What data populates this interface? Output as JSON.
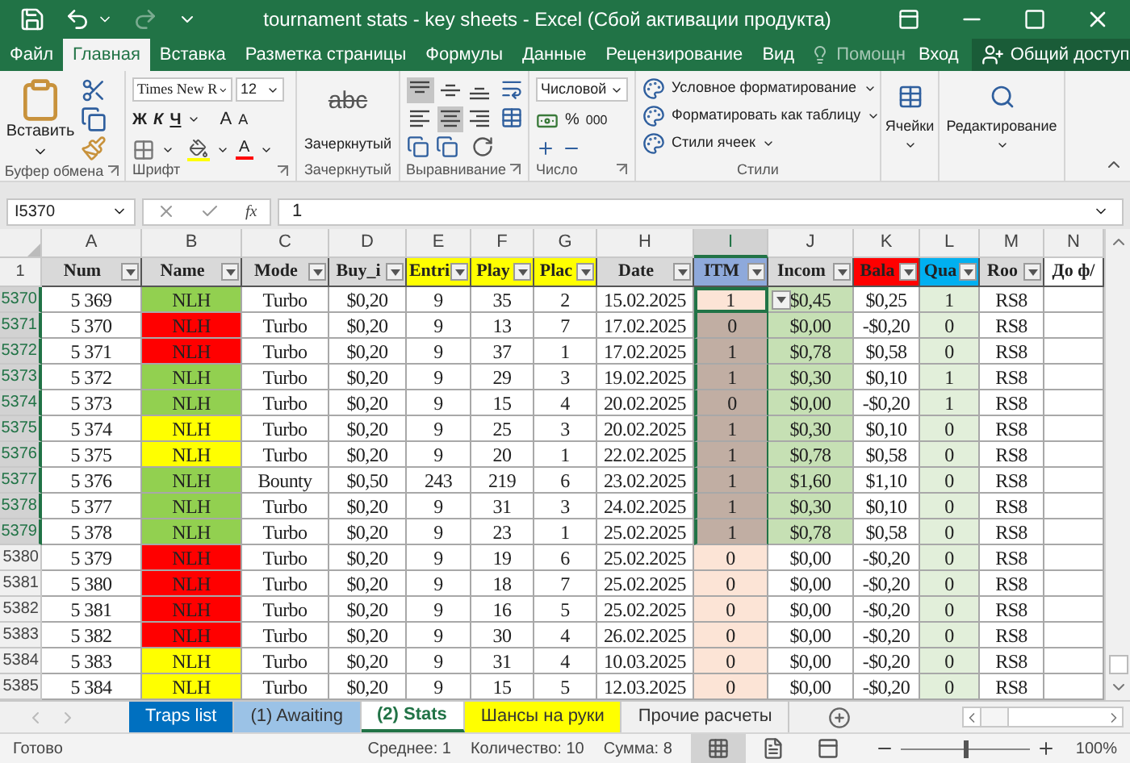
{
  "window": {
    "title": "tournament stats - key sheets - Excel (Сбой активации продукта)"
  },
  "tabs": [
    {
      "label": "Файл",
      "selected": false
    },
    {
      "label": "Главная",
      "selected": true
    },
    {
      "label": "Вставка",
      "selected": false
    },
    {
      "label": "Разметка страницы",
      "selected": false
    },
    {
      "label": "Формулы",
      "selected": false
    },
    {
      "label": "Данные",
      "selected": false
    },
    {
      "label": "Рецензирование",
      "selected": false
    },
    {
      "label": "Вид",
      "selected": false
    }
  ],
  "tell_me": "Помощн",
  "sign_in": "Вход",
  "share": "Общий доступ",
  "ribbon": {
    "clipboard": {
      "paste": "Вставить",
      "label": "Буфер обмена"
    },
    "font": {
      "name": "Times New R",
      "size": "12",
      "bold": "Ж",
      "italic": "К",
      "underline": "Ч",
      "grow": "A",
      "shrink": "A",
      "font_color": "A",
      "label": "Шрифт"
    },
    "strike": {
      "sample": "abc",
      "button": "Зачеркнутый",
      "label": "Зачеркнутый"
    },
    "alignment": {
      "buttons": [
        {
          "kind": "top",
          "selected": true
        },
        {
          "kind": "middle",
          "selected": false
        },
        {
          "kind": "bottom",
          "selected": false
        },
        {
          "kind": "left",
          "selected": false
        },
        {
          "kind": "center",
          "selected": true
        },
        {
          "kind": "right",
          "selected": false
        }
      ],
      "label": "Выравнивание"
    },
    "number": {
      "format": "Числовой",
      "percent": "%",
      "thousands": "000",
      "label": "Число"
    },
    "styles": {
      "items": [
        "Условное форматирование",
        "Форматировать как таблицу",
        "Стили ячеек"
      ],
      "label": "Стили"
    },
    "cells": {
      "button": "Ячейки"
    },
    "editing": {
      "button": "Редактирование"
    }
  },
  "formula_bar": {
    "name_box": "I5370",
    "fx": "fx",
    "value": "1"
  },
  "columns": [
    {
      "label": "A",
      "selected": false
    },
    {
      "label": "B",
      "selected": false
    },
    {
      "label": "C",
      "selected": false
    },
    {
      "label": "D",
      "selected": false
    },
    {
      "label": "E",
      "selected": false
    },
    {
      "label": "F",
      "selected": false
    },
    {
      "label": "G",
      "selected": false
    },
    {
      "label": "H",
      "selected": false
    },
    {
      "label": "I",
      "selected": true
    },
    {
      "label": "J",
      "selected": false
    },
    {
      "label": "K",
      "selected": false
    },
    {
      "label": "L",
      "selected": false
    },
    {
      "label": "M",
      "selected": false
    },
    {
      "label": "N",
      "selected": false
    }
  ],
  "header_row": {
    "row_number": "1",
    "cells": [
      {
        "text": "Num",
        "color": "#d9d9d9",
        "filter": true
      },
      {
        "text": "Name",
        "color": "#d9d9d9",
        "filter": true
      },
      {
        "text": "Mode",
        "color": "#d9d9d9",
        "filter": true
      },
      {
        "text": "Buy_i",
        "color": "#d9d9d9",
        "filter": true
      },
      {
        "text": "Entri",
        "color": "#ffff00",
        "filter": true
      },
      {
        "text": "Play",
        "color": "#ffff00",
        "filter": true
      },
      {
        "text": "Plac",
        "color": "#ffff00",
        "filter": true
      },
      {
        "text": "Date",
        "color": "#d9d9d9",
        "filter": true
      },
      {
        "text": "ITM",
        "color": "#8ea9db",
        "filter": true
      },
      {
        "text": "Incom",
        "color": "#d9d9d9",
        "filter": true
      },
      {
        "text": "Bala",
        "color": "#ff0000",
        "filter": true
      },
      {
        "text": "Qua",
        "color": "#00b0f0",
        "filter": true
      },
      {
        "text": "Roo",
        "color": "#d9d9d9",
        "filter": true
      },
      {
        "text": "До ф/",
        "color": "#ffffff",
        "filter": false
      }
    ]
  },
  "rows": [
    {
      "row_number": "5370",
      "selected": true,
      "active": true,
      "num": "5 369",
      "name": {
        "text": "NLH",
        "color": "#92d050"
      },
      "mode": "Turbo",
      "buy_in": "$0,20",
      "entries": "9",
      "players": "35",
      "place": "2",
      "date": "15.02.2025",
      "itm": "1",
      "income": {
        "text": "$0,45",
        "color": "#c6e0b4"
      },
      "balance": "$0,25",
      "qual": "1",
      "room": "RS8"
    },
    {
      "row_number": "5371",
      "selected": true,
      "active": false,
      "num": "5 370",
      "name": {
        "text": "NLH",
        "color": "#ff0000"
      },
      "mode": "Turbo",
      "buy_in": "$0,20",
      "entries": "9",
      "players": "13",
      "place": "7",
      "date": "17.02.2025",
      "itm": "0",
      "income": {
        "text": "$0,00",
        "color": "#c6e0b4"
      },
      "balance": "-$0,20",
      "qual": "0",
      "room": "RS8"
    },
    {
      "row_number": "5372",
      "selected": true,
      "active": false,
      "num": "5 371",
      "name": {
        "text": "NLH",
        "color": "#ff0000"
      },
      "mode": "Turbo",
      "buy_in": "$0,20",
      "entries": "9",
      "players": "37",
      "place": "1",
      "date": "17.02.2025",
      "itm": "1",
      "income": {
        "text": "$0,78",
        "color": "#c6e0b4"
      },
      "balance": "$0,58",
      "qual": "0",
      "room": "RS8"
    },
    {
      "row_number": "5373",
      "selected": true,
      "active": false,
      "num": "5 372",
      "name": {
        "text": "NLH",
        "color": "#92d050"
      },
      "mode": "Turbo",
      "buy_in": "$0,20",
      "entries": "9",
      "players": "29",
      "place": "3",
      "date": "19.02.2025",
      "itm": "1",
      "income": {
        "text": "$0,30",
        "color": "#c6e0b4"
      },
      "balance": "$0,10",
      "qual": "1",
      "room": "RS8"
    },
    {
      "row_number": "5374",
      "selected": true,
      "active": false,
      "num": "5 373",
      "name": {
        "text": "NLH",
        "color": "#92d050"
      },
      "mode": "Turbo",
      "buy_in": "$0,20",
      "entries": "9",
      "players": "15",
      "place": "4",
      "date": "20.02.2025",
      "itm": "0",
      "income": {
        "text": "$0,00",
        "color": "#c6e0b4"
      },
      "balance": "-$0,20",
      "qual": "1",
      "room": "RS8"
    },
    {
      "row_number": "5375",
      "selected": true,
      "active": false,
      "num": "5 374",
      "name": {
        "text": "NLH",
        "color": "#ffff00"
      },
      "mode": "Turbo",
      "buy_in": "$0,20",
      "entries": "9",
      "players": "25",
      "place": "3",
      "date": "20.02.2025",
      "itm": "1",
      "income": {
        "text": "$0,30",
        "color": "#c6e0b4"
      },
      "balance": "$0,10",
      "qual": "0",
      "room": "RS8"
    },
    {
      "row_number": "5376",
      "selected": true,
      "active": false,
      "num": "5 375",
      "name": {
        "text": "NLH",
        "color": "#ffff00"
      },
      "mode": "Turbo",
      "buy_in": "$0,20",
      "entries": "9",
      "players": "20",
      "place": "1",
      "date": "22.02.2025",
      "itm": "1",
      "income": {
        "text": "$0,78",
        "color": "#c6e0b4"
      },
      "balance": "$0,58",
      "qual": "0",
      "room": "RS8"
    },
    {
      "row_number": "5377",
      "selected": true,
      "active": false,
      "num": "5 376",
      "name": {
        "text": "NLH",
        "color": "#92d050"
      },
      "mode": "Bounty",
      "buy_in": "$0,50",
      "entries": "243",
      "players": "219",
      "place": "6",
      "date": "23.02.2025",
      "itm": "1",
      "income": {
        "text": "$1,60",
        "color": "#c6e0b4"
      },
      "balance": "$1,10",
      "qual": "0",
      "room": "RS8"
    },
    {
      "row_number": "5378",
      "selected": true,
      "active": false,
      "num": "5 377",
      "name": {
        "text": "NLH",
        "color": "#92d050"
      },
      "mode": "Turbo",
      "buy_in": "$0,20",
      "entries": "9",
      "players": "31",
      "place": "3",
      "date": "24.02.2025",
      "itm": "1",
      "income": {
        "text": "$0,30",
        "color": "#c6e0b4"
      },
      "balance": "$0,10",
      "qual": "0",
      "room": "RS8"
    },
    {
      "row_number": "5379",
      "selected": true,
      "active": false,
      "num": "5 378",
      "name": {
        "text": "NLH",
        "color": "#92d050"
      },
      "mode": "Turbo",
      "buy_in": "$0,20",
      "entries": "9",
      "players": "23",
      "place": "1",
      "date": "25.02.2025",
      "itm": "1",
      "income": {
        "text": "$0,78",
        "color": "#c6e0b4"
      },
      "balance": "$0,58",
      "qual": "0",
      "room": "RS8"
    },
    {
      "row_number": "5380",
      "selected": false,
      "active": false,
      "num": "5 379",
      "name": {
        "text": "NLH",
        "color": "#ff0000"
      },
      "mode": "Turbo",
      "buy_in": "$0,20",
      "entries": "9",
      "players": "19",
      "place": "6",
      "date": "25.02.2025",
      "itm": "0",
      "income": {
        "text": "$0,00",
        "color": "#ffffff"
      },
      "balance": "-$0,20",
      "qual": "0",
      "room": "RS8"
    },
    {
      "row_number": "5381",
      "selected": false,
      "active": false,
      "num": "5 380",
      "name": {
        "text": "NLH",
        "color": "#ff0000"
      },
      "mode": "Turbo",
      "buy_in": "$0,20",
      "entries": "9",
      "players": "18",
      "place": "7",
      "date": "25.02.2025",
      "itm": "0",
      "income": {
        "text": "$0,00",
        "color": "#ffffff"
      },
      "balance": "-$0,20",
      "qual": "0",
      "room": "RS8"
    },
    {
      "row_number": "5382",
      "selected": false,
      "active": false,
      "num": "5 381",
      "name": {
        "text": "NLH",
        "color": "#ff0000"
      },
      "mode": "Turbo",
      "buy_in": "$0,20",
      "entries": "9",
      "players": "16",
      "place": "5",
      "date": "25.02.2025",
      "itm": "0",
      "income": {
        "text": "$0,00",
        "color": "#ffffff"
      },
      "balance": "-$0,20",
      "qual": "0",
      "room": "RS8"
    },
    {
      "row_number": "5383",
      "selected": false,
      "active": false,
      "num": "5 382",
      "name": {
        "text": "NLH",
        "color": "#ff0000"
      },
      "mode": "Turbo",
      "buy_in": "$0,20",
      "entries": "9",
      "players": "30",
      "place": "4",
      "date": "26.02.2025",
      "itm": "0",
      "income": {
        "text": "$0,00",
        "color": "#ffffff"
      },
      "balance": "-$0,20",
      "qual": "0",
      "room": "RS8"
    },
    {
      "row_number": "5384",
      "selected": false,
      "active": false,
      "num": "5 383",
      "name": {
        "text": "NLH",
        "color": "#ffff00"
      },
      "mode": "Turbo",
      "buy_in": "$0,20",
      "entries": "9",
      "players": "31",
      "place": "4",
      "date": "10.03.2025",
      "itm": "0",
      "income": {
        "text": "$0,00",
        "color": "#ffffff"
      },
      "balance": "-$0,20",
      "qual": "0",
      "room": "RS8"
    },
    {
      "row_number": "5385",
      "selected": false,
      "active": false,
      "num": "5 384",
      "name": {
        "text": "NLH",
        "color": "#ffff00"
      },
      "mode": "Turbo",
      "buy_in": "$0,20",
      "entries": "9",
      "players": "15",
      "place": "5",
      "date": "12.03.2025",
      "itm": "0",
      "income": {
        "text": "$0,00",
        "color": "#ffffff"
      },
      "balance": "-$0,20",
      "qual": "0",
      "room": "RS8"
    }
  ],
  "sheet_tabs": [
    {
      "label": "Traps list",
      "selected": false,
      "color": "#0070c0"
    },
    {
      "label": "(1) Awaiting",
      "selected": false,
      "color": "#9bc2e6"
    },
    {
      "label": "(2) Stats",
      "selected": true,
      "color": "#ffffff"
    },
    {
      "label": "Шансы на руки",
      "selected": false,
      "color": "#ffff00"
    },
    {
      "label": "Прочие расчеты",
      "selected": false,
      "color": "#f0f0f0"
    }
  ],
  "status_bar": {
    "ready": "Готово",
    "average": "Среднее: 1",
    "count": "Количество: 10",
    "sum": "Сумма: 8",
    "view_buttons": [
      {
        "kind": "normal",
        "selected": true
      },
      {
        "kind": "page_layout",
        "selected": false
      },
      {
        "kind": "page_break",
        "selected": false
      }
    ],
    "zoom": {
      "level": 0.5,
      "label": "100%"
    }
  }
}
